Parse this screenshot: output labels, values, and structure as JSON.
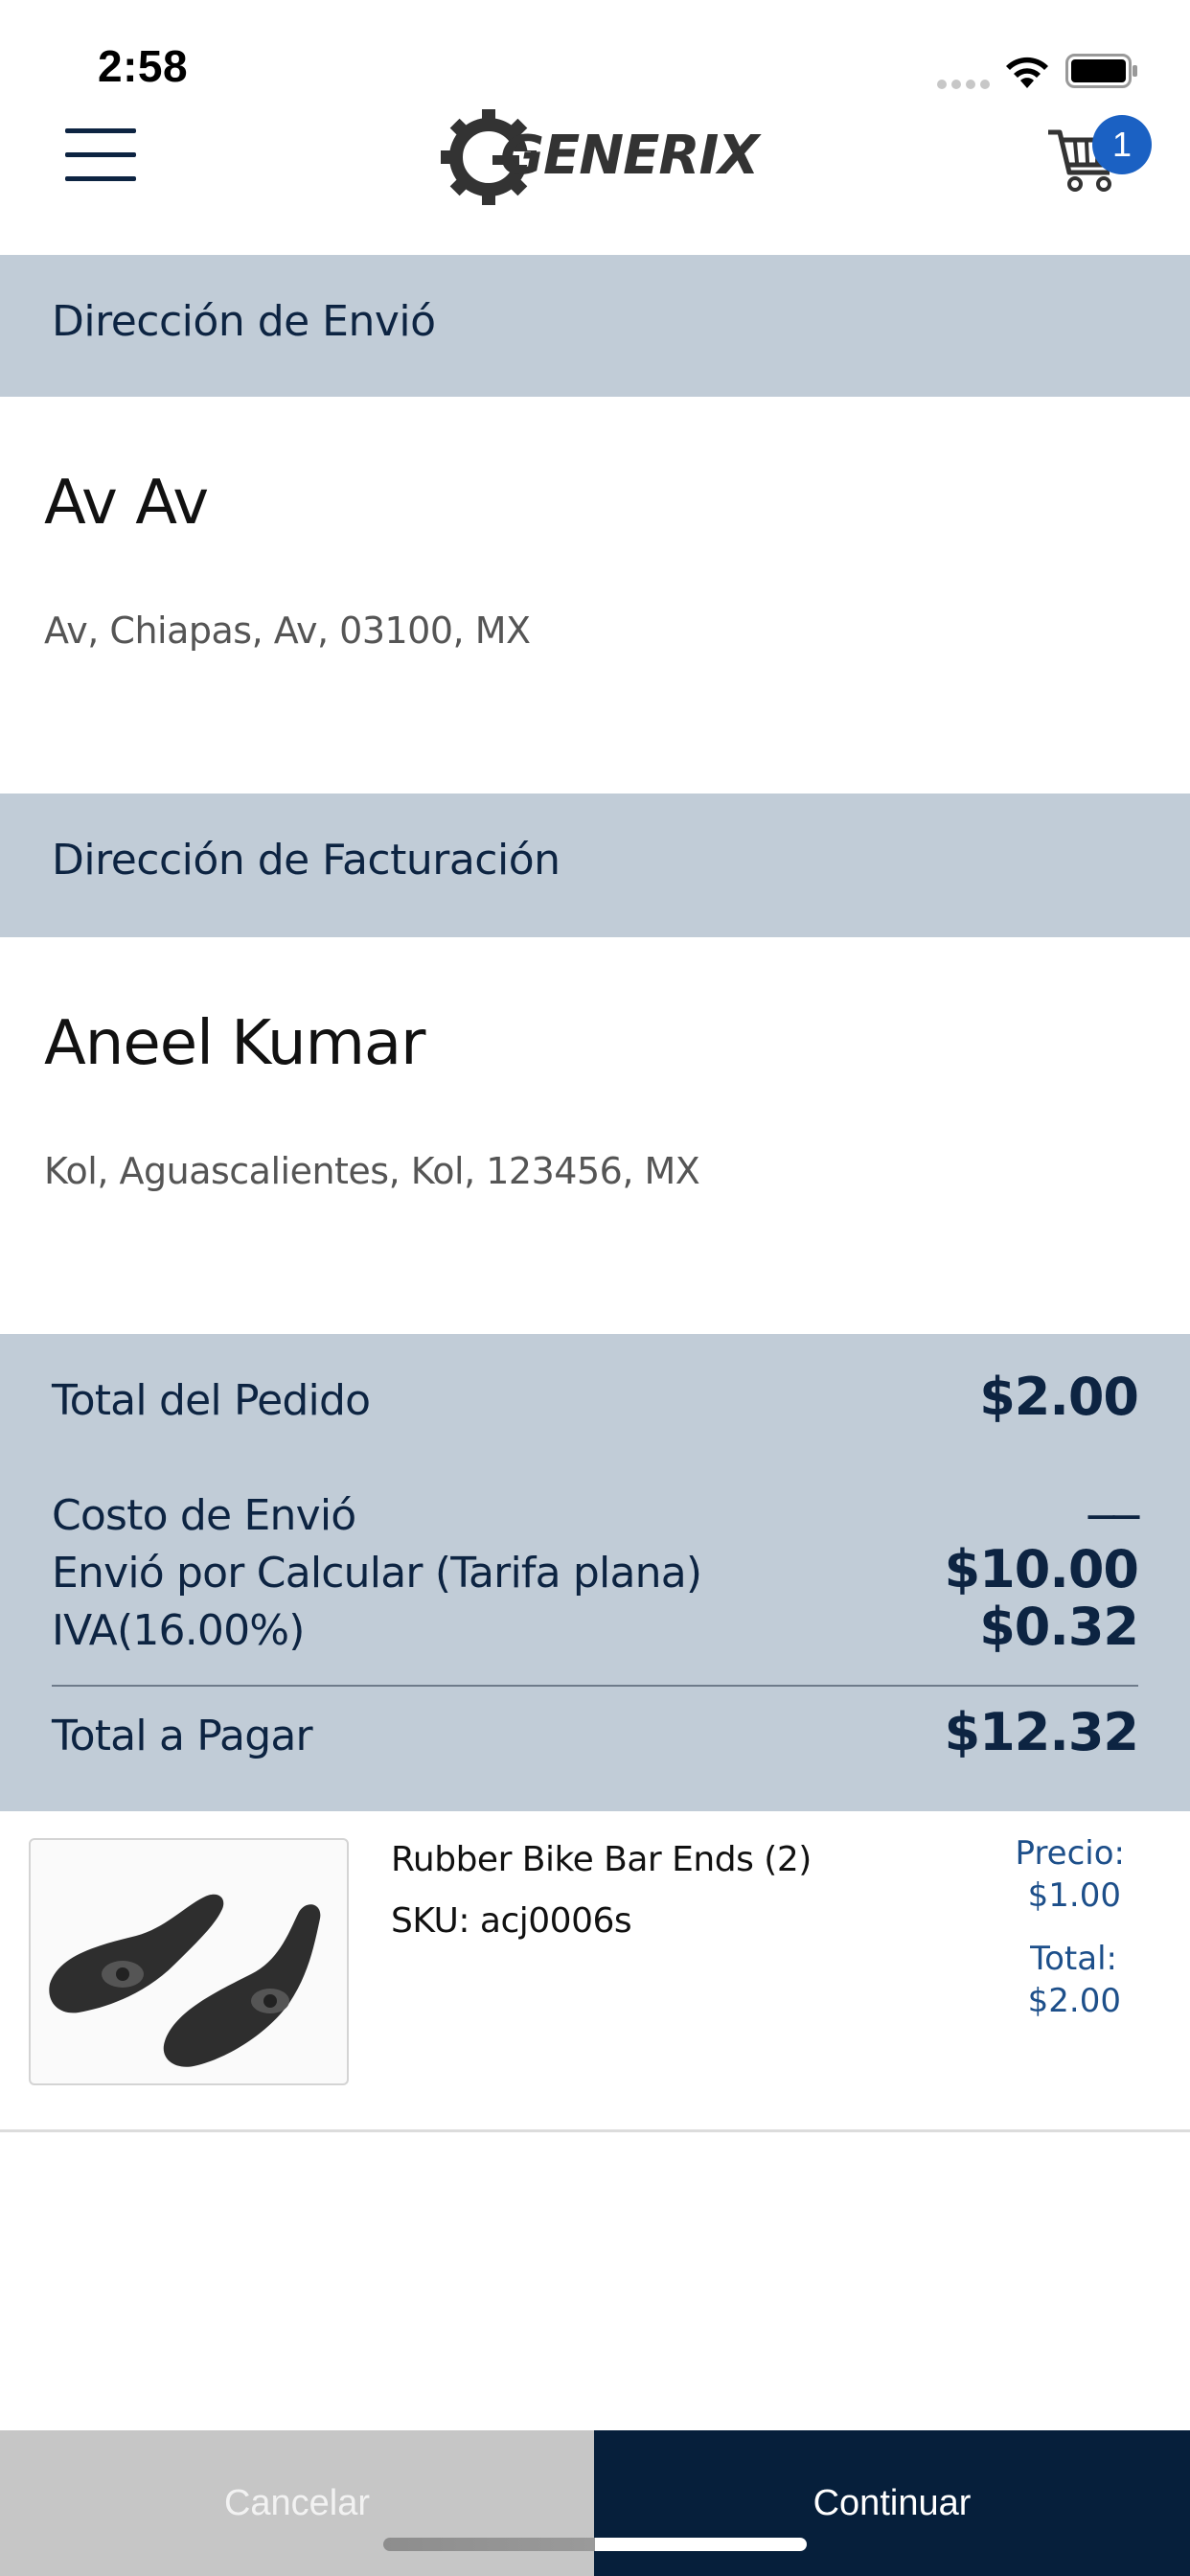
{
  "status_bar": {
    "time": "2:58"
  },
  "header": {
    "logo_text": "GENERIX",
    "cart_count": "1",
    "accent_color": "#1b61c3"
  },
  "shipping": {
    "section_title": "Dirección de Envió",
    "name": "Av Av",
    "address": "Av, Chiapas, Av, 03100, MX"
  },
  "billing": {
    "section_title": "Dirección de Facturación",
    "name": "Aneel Kumar",
    "address": "Kol, Aguascalientes, Kol, 123456, MX"
  },
  "summary": {
    "order_total_label": "Total del Pedido",
    "order_total_value": "$2.00",
    "shipping_cost_label": "Costo de Envió",
    "shipping_cost_value": "__",
    "shipping_method_label": "Envió por Calcular (Tarifa plana)",
    "shipping_method_value": "$10.00",
    "tax_label": "IVA(16.00%)",
    "tax_value": "$0.32",
    "grand_total_label": "Total a Pagar",
    "grand_total_value": "$12.32"
  },
  "product": {
    "name": "Rubber Bike Bar Ends (2)",
    "sku": "SKU: acj0006s",
    "price_label": "Precio:",
    "price_value": "$1.00",
    "total_label": "Total:",
    "total_value": "$2.00"
  },
  "footer": {
    "cancel_label": "Cancelar",
    "continue_label": "Continuar"
  },
  "colors": {
    "band": "#c1ccd7",
    "navy": "#0d2442",
    "continue_bg": "#061f3b",
    "cancel_bg": "#c6c6c6"
  }
}
